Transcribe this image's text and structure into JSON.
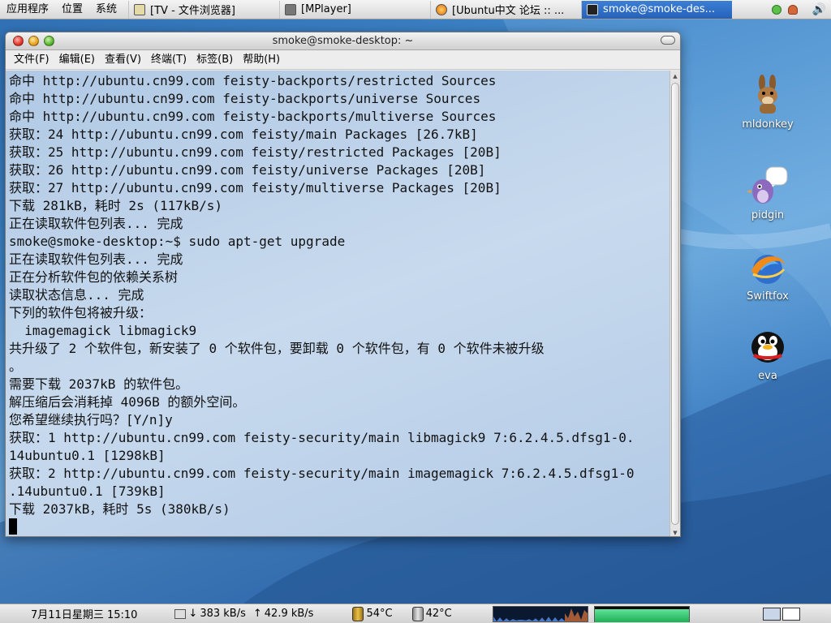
{
  "top_panel": {
    "menus": [
      "应用程序",
      "位置",
      "系统"
    ],
    "tasks": [
      {
        "label": "[TV - 文件浏览器]",
        "icon": "folder-icon",
        "active": false
      },
      {
        "label": "[MPlayer]",
        "icon": "mplayer-window-icon",
        "active": false
      },
      {
        "label": "[Ubuntu中文 论坛 :: ...",
        "icon": "swiftfox-icon",
        "active": false
      },
      {
        "label": "smoke@smoke-des...",
        "icon": "terminal-icon",
        "active": true
      }
    ],
    "tray_icons": [
      "network-status-icon",
      "user-switch-icon",
      "volume-icon"
    ]
  },
  "terminal": {
    "title": "smoke@smoke-desktop: ~",
    "menus": [
      "文件(F)",
      "编辑(E)",
      "查看(V)",
      "终端(T)",
      "标签(B)",
      "帮助(H)"
    ],
    "lines": [
      "命中 http://ubuntu.cn99.com feisty-backports/restricted Sources",
      "命中 http://ubuntu.cn99.com feisty-backports/universe Sources",
      "命中 http://ubuntu.cn99.com feisty-backports/multiverse Sources",
      "获取：24 http://ubuntu.cn99.com feisty/main Packages [26.7kB]",
      "获取：25 http://ubuntu.cn99.com feisty/restricted Packages [20B]",
      "获取：26 http://ubuntu.cn99.com feisty/universe Packages [20B]",
      "获取：27 http://ubuntu.cn99.com feisty/multiverse Packages [20B]",
      "下载 281kB，耗时 2s (117kB/s)",
      "正在读取软件包列表... 完成",
      "smoke@smoke-desktop:~$ sudo apt-get upgrade",
      "正在读取软件包列表... 完成",
      "正在分析软件包的依赖关系树",
      "读取状态信息... 完成",
      "下列的软件包将被升级：",
      "  imagemagick libmagick9",
      "共升级了 2 个软件包，新安装了 0 个软件包，要卸载 0 个软件包，有 0 个软件未被升级",
      "。",
      "需要下载 2037kB 的软件包。",
      "解压缩后会消耗掉 4096B 的额外空间。",
      "您希望继续执行吗？[Y/n]y",
      "获取：1 http://ubuntu.cn99.com feisty-security/main libmagick9 7:6.2.4.5.dfsg1-0.",
      "14ubuntu0.1 [1298kB]",
      "获取：2 http://ubuntu.cn99.com feisty-security/main imagemagick 7:6.2.4.5.dfsg1-0",
      ".14ubuntu0.1 [739kB]",
      "下载 2037kB，耗时 5s (380kB/s)"
    ]
  },
  "desktop_icons": [
    {
      "label": "mldonkey",
      "icon": "mldonkey-donkey-icon"
    },
    {
      "label": "pidgin",
      "icon": "pidgin-bird-icon"
    },
    {
      "label": "Swiftfox",
      "icon": "swiftfox-globe-icon"
    },
    {
      "label": "eva",
      "icon": "eva-penguin-icon"
    }
  ],
  "bottom_panel": {
    "clock": "7月11日星期三 15:10",
    "net_down": "383 kB/s",
    "net_up": "42.9 kB/s",
    "temp1": "54°C",
    "temp2": "42°C",
    "workspaces": 2,
    "current_workspace": 1
  },
  "colors": {
    "panel_active_task": "#2561b8",
    "terminal_bg": "#bed2e8",
    "cpu_graph": "#4a78c8",
    "mem_graph": "#2ecf6e"
  }
}
